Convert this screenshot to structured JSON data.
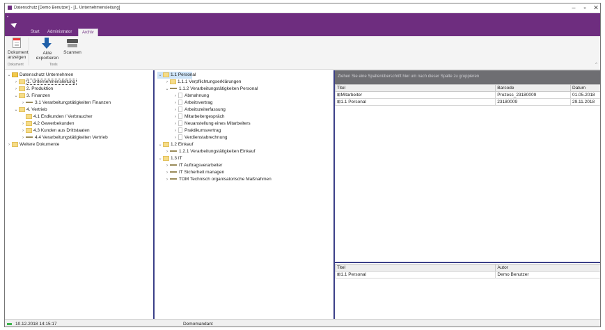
{
  "window": {
    "title": "Datenschutz [Demo Benutzer] - [1. Unternehmensleitung]",
    "controls": {
      "minimize": "–",
      "maximize": "▫",
      "close": "✕"
    }
  },
  "ribbon": {
    "tabs": [
      {
        "label": "Start",
        "active": false
      },
      {
        "label": "Administrator",
        "active": false
      },
      {
        "label": "Archiv",
        "active": true
      }
    ],
    "buttons": {
      "dokument": "Dokument",
      "anzeigen": "anzeigen",
      "akte": "Akte",
      "exportieren": "exportieren",
      "scannen": "Scannen"
    },
    "groups": {
      "dokument": "Dokument",
      "tools": "Tools"
    },
    "collapse": "^"
  },
  "left_tree": [
    {
      "label": "Datenschutz Unternehmen",
      "toggle": "⌄"
    },
    {
      "label": "1. Unternehmensleitung",
      "toggle": "›"
    },
    {
      "label": "2. Produktion",
      "toggle": "›"
    },
    {
      "label": "3. Finanzen",
      "toggle": "⌄"
    },
    {
      "label": "3.1 Verarbeitungstätigkeiten Finanzen",
      "toggle": "›"
    },
    {
      "label": "4. Vertrieb",
      "toggle": "⌄"
    },
    {
      "label": "4.1 Endkunden / Verbraucher",
      "toggle": ""
    },
    {
      "label": "4.2 Gewerbekunden",
      "toggle": "›"
    },
    {
      "label": "4.3 Kunden aus Drittstaaten",
      "toggle": "›"
    },
    {
      "label": "4.4 Verarbeitungstätigkeiten Vertrieb",
      "toggle": "›"
    },
    {
      "label": "Weitere Dokumente",
      "toggle": "›"
    }
  ],
  "middle_tree": [
    {
      "label": "1.1 Personal",
      "toggle": "⌄"
    },
    {
      "label": "1.1.1 Verpflichtungserklärungen",
      "toggle": "›"
    },
    {
      "label": "1.1.2 Verarbeitungstätigkeiten Personal",
      "toggle": "⌄"
    },
    {
      "label": "Abmahnung",
      "toggle": "›"
    },
    {
      "label": "Arbeitsvertrag",
      "toggle": "›"
    },
    {
      "label": "Arbeitszeiterfassung",
      "toggle": "›"
    },
    {
      "label": "Mitarbeitergespräch",
      "toggle": "›"
    },
    {
      "label": "Neuanstellung eines Mitarbeiters",
      "toggle": "›"
    },
    {
      "label": "Praktikumsvertrag",
      "toggle": "›"
    },
    {
      "label": "Verdienstabrechnung",
      "toggle": "›"
    },
    {
      "label": "1.2 Einkauf",
      "toggle": "⌄"
    },
    {
      "label": "1.2.1 Verarbeitungstätigkeiten Einkauf",
      "toggle": "›"
    },
    {
      "label": "1.3 IT",
      "toggle": "⌄"
    },
    {
      "label": "IT Auftragsverarbeiter",
      "toggle": "›"
    },
    {
      "label": "IT Sicherheit managen",
      "toggle": "›"
    },
    {
      "label": "TOM Technisch organisatorische Maßnahmen",
      "toggle": "›"
    }
  ],
  "grid": {
    "group_hint": "Ziehen Sie eine Spaltenüberschrift hier um nach dieser Spalte zu gruppieren",
    "columns": [
      "Titel",
      "Barcode",
      "Datum"
    ],
    "rows": [
      [
        "Mitarbeiter",
        "Prozess_23180009",
        "01.05.2018"
      ],
      [
        "1.1 Personal",
        "23180009",
        "29.11.2018"
      ]
    ]
  },
  "lower_grid": {
    "columns": [
      "Titel",
      "Autor"
    ],
    "rows": [
      [
        "1.1 Personal",
        "Demo Benutzer"
      ]
    ]
  },
  "statusbar": {
    "datetime": "10.12.2018 14:15:17",
    "mandant": "Demomandant"
  },
  "colors": {
    "brand_purple": "#6e2d7f",
    "separator_blue": "#3a3f88",
    "selection": "#cde3f7",
    "folder": "#f2c94c"
  }
}
